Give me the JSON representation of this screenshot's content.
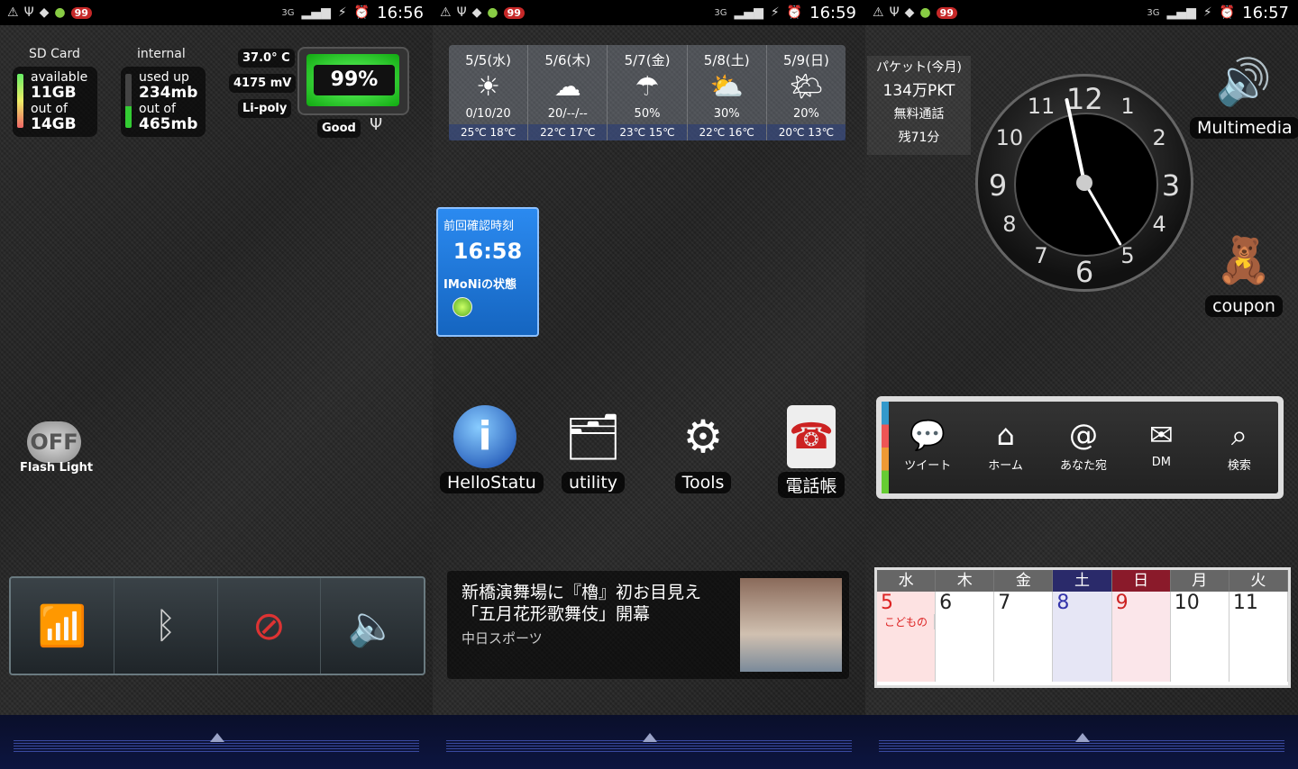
{
  "status_bars": [
    {
      "badge": "99",
      "network": "3G",
      "time": "16:56"
    },
    {
      "badge": "99",
      "network": "3G",
      "time": "16:59"
    },
    {
      "badge": "99",
      "network": "3G",
      "time": "16:57"
    }
  ],
  "screen1": {
    "sd": {
      "label": "SD Card",
      "l1": "available",
      "v1": "11GB",
      "l2": "out of",
      "v2": "14GB"
    },
    "internal": {
      "label": "internal",
      "l1": "used up",
      "v1": "234mb",
      "l2": "out of",
      "v2": "465mb"
    },
    "battery": {
      "temp": "37.0° C",
      "voltage": "4175 mV",
      "type": "Li-poly",
      "percent": "99%",
      "level": 0.99,
      "health": "Good"
    },
    "flash": {
      "state": "OFF",
      "label": "Flash Light"
    }
  },
  "screen2": {
    "weather": [
      {
        "date": "5/5(水)",
        "icon": "sunny",
        "prob": "0/10/20",
        "temp": "25℃  18℃"
      },
      {
        "date": "5/6(木)",
        "icon": "cloudy",
        "prob": "20/--/--",
        "temp": "22℃  17℃"
      },
      {
        "date": "5/7(金)",
        "icon": "rain",
        "prob": "50%",
        "temp": "23℃  15℃"
      },
      {
        "date": "5/8(土)",
        "icon": "cloudy-sun",
        "prob": "30%",
        "temp": "22℃  16℃"
      },
      {
        "date": "5/9(日)",
        "icon": "sun-cloud",
        "prob": "20%",
        "temp": "20℃  13℃"
      }
    ],
    "imoni": {
      "title": "前回確認時刻",
      "time": "16:58",
      "status_label": "IMoNiの状態"
    },
    "apps": [
      {
        "label": "HelloStatu",
        "icon": "info-icon"
      },
      {
        "label": "utility",
        "icon": "folder-icon"
      },
      {
        "label": "Tools",
        "icon": "tools-icon"
      },
      {
        "label": "電話帳",
        "icon": "phonebook-icon"
      }
    ],
    "news": {
      "title": "新橋演舞場に『櫓』初お目見え「五月花形歌舞伎」開幕",
      "source": "中日スポーツ"
    }
  },
  "screen3": {
    "packet": {
      "l1": "パケット(今月)",
      "l2": "134万PKT",
      "l3": "無料通話",
      "l4": "残71分"
    },
    "clock_numbers": [
      "12",
      "1",
      "2",
      "3",
      "4",
      "5",
      "6",
      "7",
      "8",
      "9",
      "10",
      "11"
    ],
    "apps": [
      {
        "label": "Multimedia"
      },
      {
        "label": "coupon"
      }
    ],
    "shortcuts": [
      {
        "label": "ツイート",
        "icon": "tweet-icon"
      },
      {
        "label": "ホーム",
        "icon": "home-icon"
      },
      {
        "label": "あなた宛",
        "icon": "mention-icon"
      },
      {
        "label": "DM",
        "icon": "mail-icon"
      },
      {
        "label": "検索",
        "icon": "search-icon"
      }
    ],
    "calendar": {
      "days": [
        "水",
        "木",
        "金",
        "土",
        "日",
        "月",
        "火"
      ],
      "dates": [
        "5",
        "6",
        "7",
        "8",
        "9",
        "10",
        "11"
      ],
      "holiday_note": "こどもの"
    }
  }
}
